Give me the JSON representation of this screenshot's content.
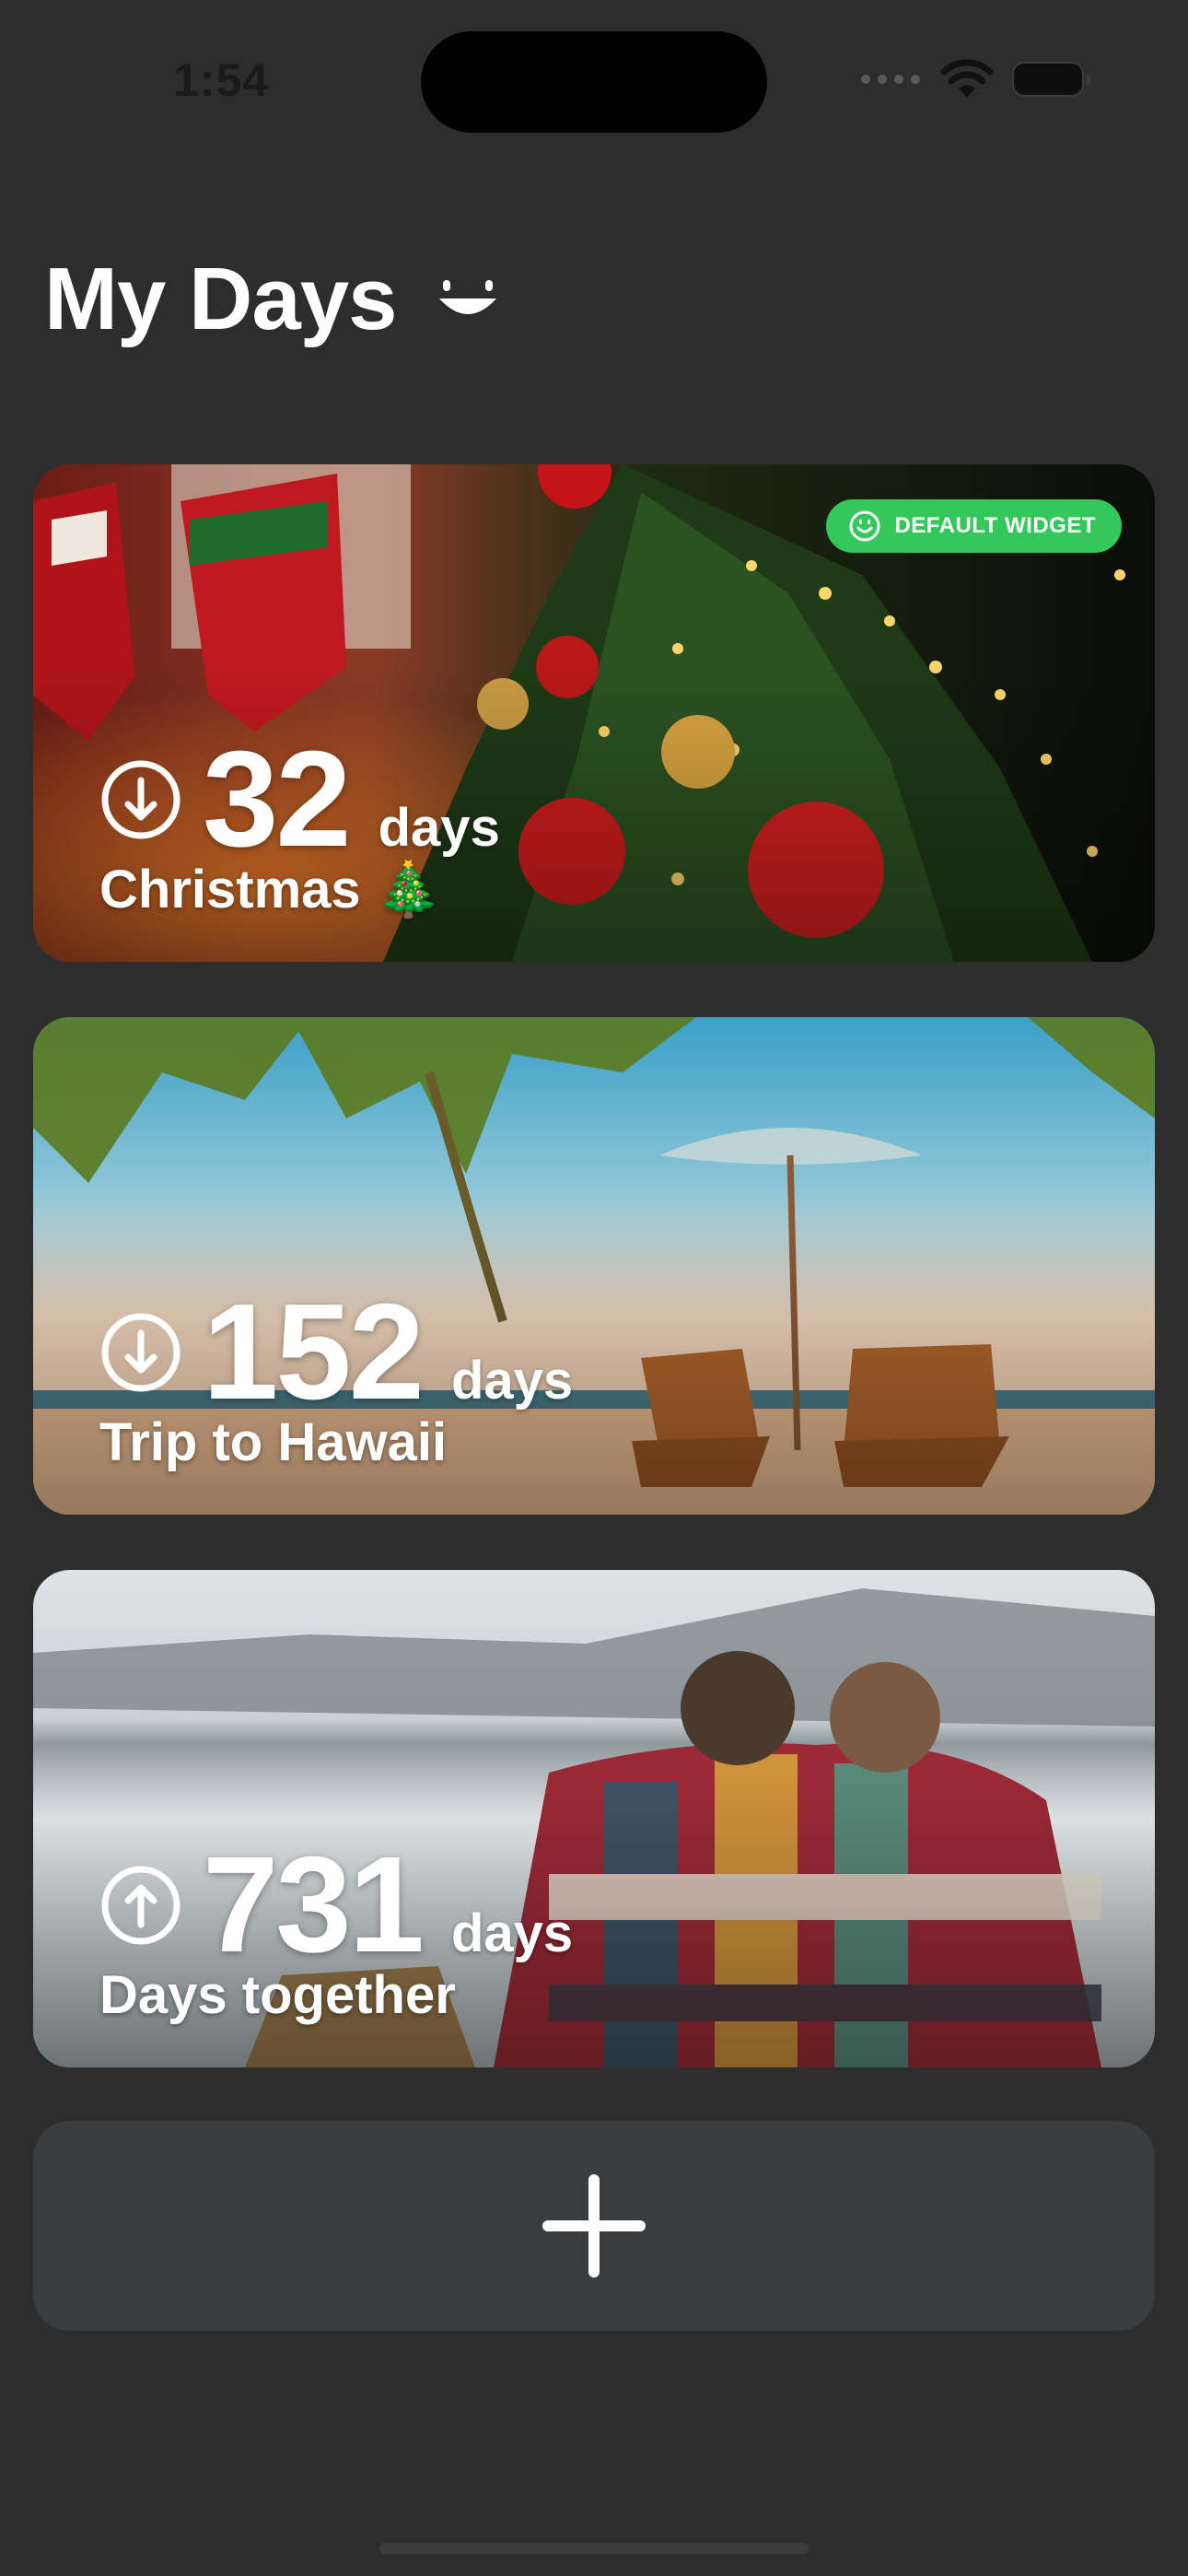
{
  "status_bar": {
    "time": "1:54"
  },
  "header": {
    "title": "My Days"
  },
  "badge": {
    "label": "DEFAULT WIDGET"
  },
  "cards": [
    {
      "count": "32",
      "unit": "days",
      "label": "Christmas 🎄",
      "direction": "down",
      "icon": "arrow-down-circle-icon"
    },
    {
      "count": "152",
      "unit": "days",
      "label": "Trip to Hawaii",
      "direction": "down",
      "icon": "arrow-down-circle-icon"
    },
    {
      "count": "731",
      "unit": "days",
      "label": "Days together",
      "direction": "up",
      "icon": "arrow-up-circle-icon"
    }
  ],
  "colors": {
    "background": "#2d2d2e",
    "badge": "#34c759",
    "add_card": "#3b3c3e"
  }
}
